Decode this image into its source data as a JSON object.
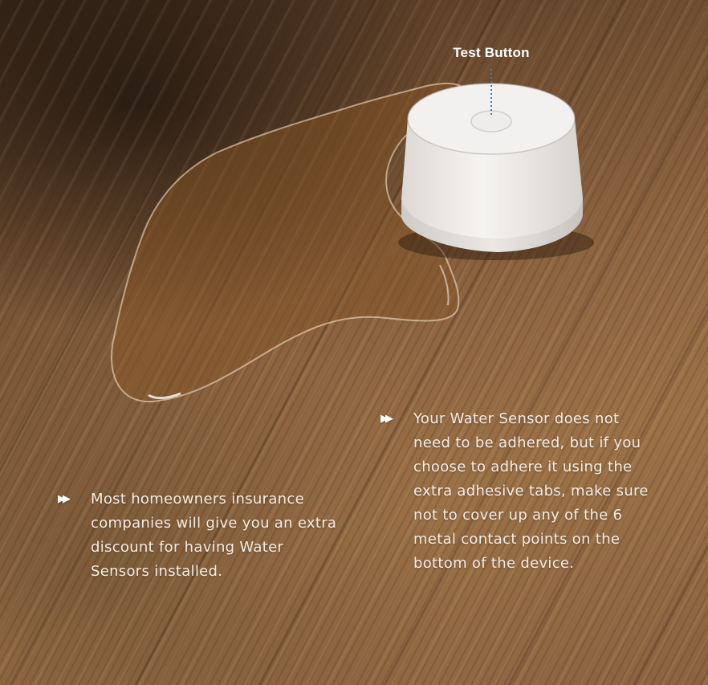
{
  "callout": {
    "label": "Test Button"
  },
  "tips": [
    {
      "bullet_icon": "fast-forward-icon",
      "text": "Most homeowners insurance companies will give you an extra discount for having Water Sensors installed."
    },
    {
      "bullet_icon": "fast-forward-icon",
      "text": "Your Water Sensor does not need to be adhered, but if you choose to adhere it using the extra adhesive tabs, make sure not to cover up any of the 6 metal contact points on the bottom of the device."
    }
  ],
  "colors": {
    "text": "#f6eee4",
    "callout_line": "#2f7fd6",
    "device": "#f2f0ee"
  }
}
